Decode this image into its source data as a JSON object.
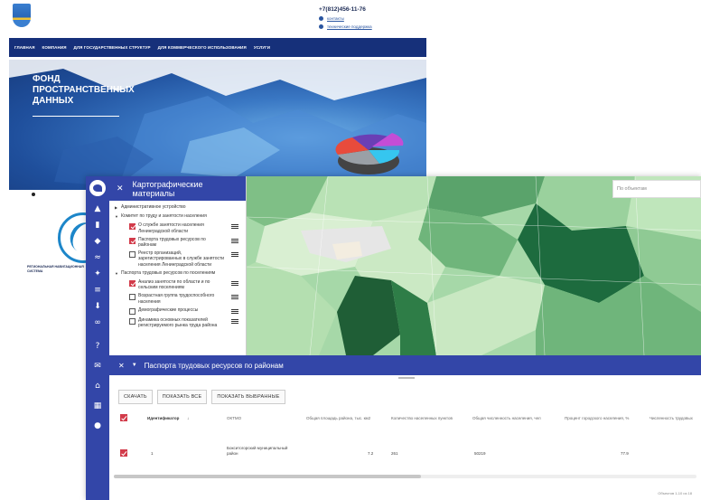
{
  "site": {
    "phone": "+7(812)456-11-76",
    "contacts": [
      "контакты",
      "технические поддержка"
    ],
    "nav": [
      "ГЛАВНАЯ",
      "КОМПАНИЯ",
      "ДЛЯ ГОСУДАРСТВЕННЫХ СТРУКТУР",
      "ДЛЯ КОММЕРЧЕСКОГО ИСПОЛЬЗОВАНИЯ",
      "УСЛУГИ"
    ],
    "hero_title": "ФОНД ПРОСТРАНСТВЕННЫХ ДАННЫХ",
    "nav_system_caption": "РЕГИОНАЛЬНАЯ НАВИГАЦИОННАЯ СИСТЕМА"
  },
  "panel": {
    "title": "Картографические материалы",
    "close_icon": "close-icon",
    "groups": [
      {
        "label": "Административное устройство",
        "layers": []
      },
      {
        "label": "Комитет по труду и занятости населения",
        "layers": [
          {
            "label": "О службе занятости населения Ленинградской области",
            "checked": true
          },
          {
            "label": "Паспорта трудовых ресурсов по районам",
            "checked": true
          },
          {
            "label": "Реестр организаций, зарегистрированных в службе занятости населения Ленинградской области",
            "checked": false
          }
        ]
      },
      {
        "label": "Паспорта трудовых ресурсов по поселениям",
        "layers": [
          {
            "label": "Анализ занятости по области и по сельским поселениям",
            "checked": true
          },
          {
            "label": "Возрастная группа трудоспособного населения",
            "checked": false
          },
          {
            "label": "Демографические процессы",
            "checked": false
          },
          {
            "label": "Динамика основных показателей регистрируемого рынка труда района",
            "checked": false
          }
        ]
      }
    ]
  },
  "map": {
    "search_placeholder": "По объектам"
  },
  "table": {
    "title": "Паспорта трудовых ресурсов по районам",
    "buttons": [
      "СКАЧАТЬ",
      "ПОКАЗАТЬ ВСЕ",
      "ПОКАЗАТЬ ВЫБРАННЫЕ"
    ],
    "columns": [
      "Идентификатор",
      "ОКТМО",
      "Общая площадь района, тыс. км2",
      "Количество населенных пунктов",
      "Общая численность населения, чел",
      "Процент городского населения, %",
      "Численность трудовых"
    ],
    "rows": [
      {
        "id": "1",
        "name": "Бокситогорский муниципальный район",
        "area": "7.2",
        "settlements": "261",
        "population": "50219",
        "urban_pct": "77.9"
      }
    ],
    "footer": "Объектов 1-10 из 18"
  },
  "colors": {
    "brand": "#3346a8",
    "site_nav": "#16307a",
    "accent_red": "#d23b4a"
  }
}
